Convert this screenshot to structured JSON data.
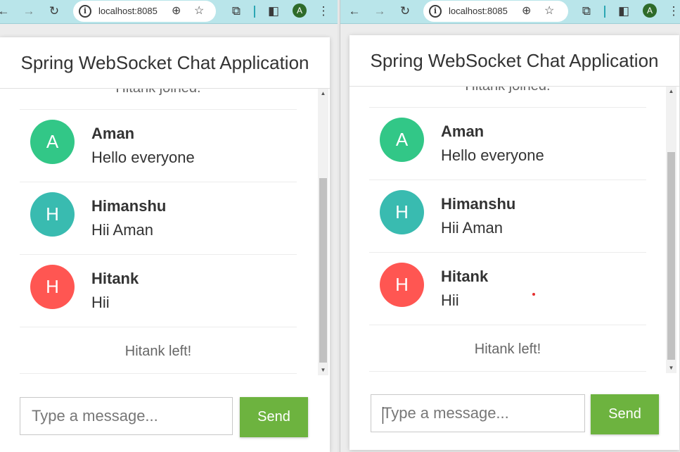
{
  "browser": {
    "url": "localhost:8085",
    "profile_initial": "A",
    "toolbar_color": "#b9e5ea"
  },
  "chat": {
    "title": "Spring WebSocket Chat Application",
    "events": {
      "joined": "Hitank joined.",
      "left": "Hitank left!"
    },
    "messages": [
      {
        "sender": "Aman",
        "initial": "A",
        "text": "Hello everyone",
        "color": "#32c787"
      },
      {
        "sender": "Himanshu",
        "initial": "H",
        "text": "Hii Aman",
        "color": "#39bbb0"
      },
      {
        "sender": "Hitank",
        "initial": "H",
        "text": "Hii",
        "color": "#ff5652"
      }
    ],
    "input_placeholder": "Type a message...",
    "send_label": "Send",
    "accent_color": "#6db33f"
  },
  "icons": {
    "back": "arrow-left-icon",
    "forward": "arrow-right-icon",
    "reload": "reload-icon",
    "site_info": "info-icon",
    "zoom": "zoom-icon",
    "bookmark": "star-icon",
    "extensions": "puzzle-icon",
    "side_panel": "side-panel-icon",
    "menu": "kebab-menu-icon"
  }
}
